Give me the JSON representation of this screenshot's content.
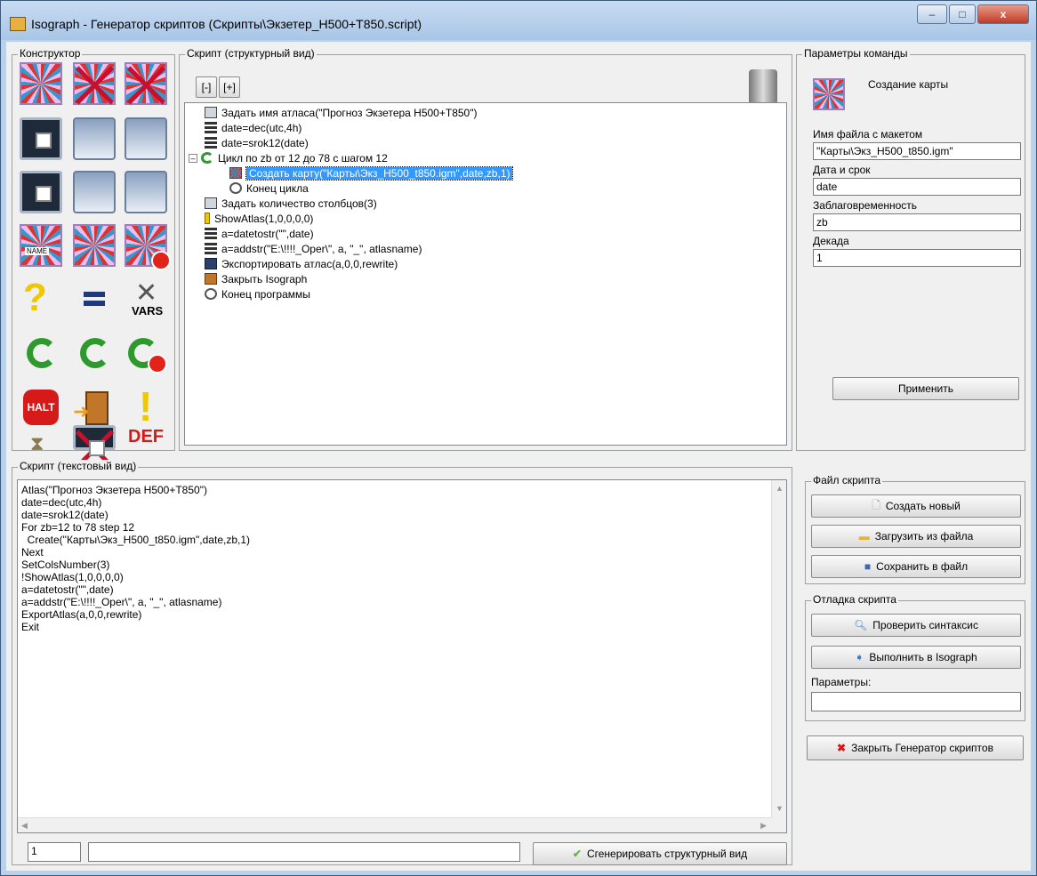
{
  "window": {
    "title": "Isograph - Генератор скриптов (Скрипты\\Экзетер_H500+T850.script)",
    "minimize": "–",
    "maximize": "□",
    "close": "x"
  },
  "constructor": {
    "label": "Конструктор",
    "vars_text": "VARS",
    "halt_text": "HALT",
    "def_text": "DEF",
    "name_text": "NAME"
  },
  "structured": {
    "label": "Скрипт (структурный вид)",
    "collapse": "[-]",
    "expand": "[+]",
    "items": [
      "Задать имя атласа(\"Прогноз Экзетера H500+T850\")",
      "date=dec(utc,4h)",
      "date=srok12(date)",
      "Цикл по zb от 12 до 78 с шагом 12",
      "Создать карту(\"Карты\\Экз_H500_t850.igm\",date,zb,1)",
      "Конец цикла",
      "Задать количество столбцов(3)",
      "ShowAtlas(1,0,0,0,0)",
      "a=datetostr(\"\",date)",
      "a=addstr(\"E:\\!!!!_Oper\\\", a, \"_\", atlasname)",
      "Экспортировать атлас(a,0,0,rewrite)",
      "Закрыть Isograph",
      "Конец программы"
    ],
    "tree_toggle": "–"
  },
  "params": {
    "label": "Параметры команды",
    "command_name": "Создание карты",
    "fields": [
      {
        "label": "Имя файла с макетом",
        "value": "\"Карты\\Экз_H500_t850.igm\""
      },
      {
        "label": "Дата и срок",
        "value": "date"
      },
      {
        "label": "Заблаговременность",
        "value": "zb"
      },
      {
        "label": "Декада",
        "value": "1"
      }
    ],
    "apply": "Применить"
  },
  "text_view": {
    "label": "Скрипт (текстовый вид)",
    "lines": [
      "Atlas(\"Прогноз Экзетера H500+T850\")",
      "date=dec(utc,4h)",
      "date=srok12(date)",
      "For zb=12 to 78 step 12",
      "  Create(\"Карты\\Экз_H500_t850.igm\",date,zb,1)",
      "Next",
      "SetColsNumber(3)",
      "!ShowAtlas(1,0,0,0,0)",
      "a=datetostr(\"\",date)",
      "a=addstr(\"E:\\!!!!_Oper\\\", a, \"_\", atlasname)",
      "ExportAtlas(a,0,0,rewrite)",
      "Exit"
    ],
    "status_line": "1",
    "status_text": "",
    "generate": "Сгенерировать структурный вид"
  },
  "file_group": {
    "label": "Файл скрипта",
    "new": "Создать новый",
    "load": "Загрузить из файла",
    "save": "Сохранить в файл"
  },
  "debug_group": {
    "label": "Отладка скрипта",
    "check": "Проверить синтаксис",
    "run": "Выполнить в Isograph",
    "params_label": "Параметры:",
    "params_value": ""
  },
  "close_generator": "Закрыть Генератор скриптов",
  "colors": {
    "selection": "#3399ff",
    "loop_green": "#2e9a2e",
    "stop_red": "#c8102e"
  }
}
